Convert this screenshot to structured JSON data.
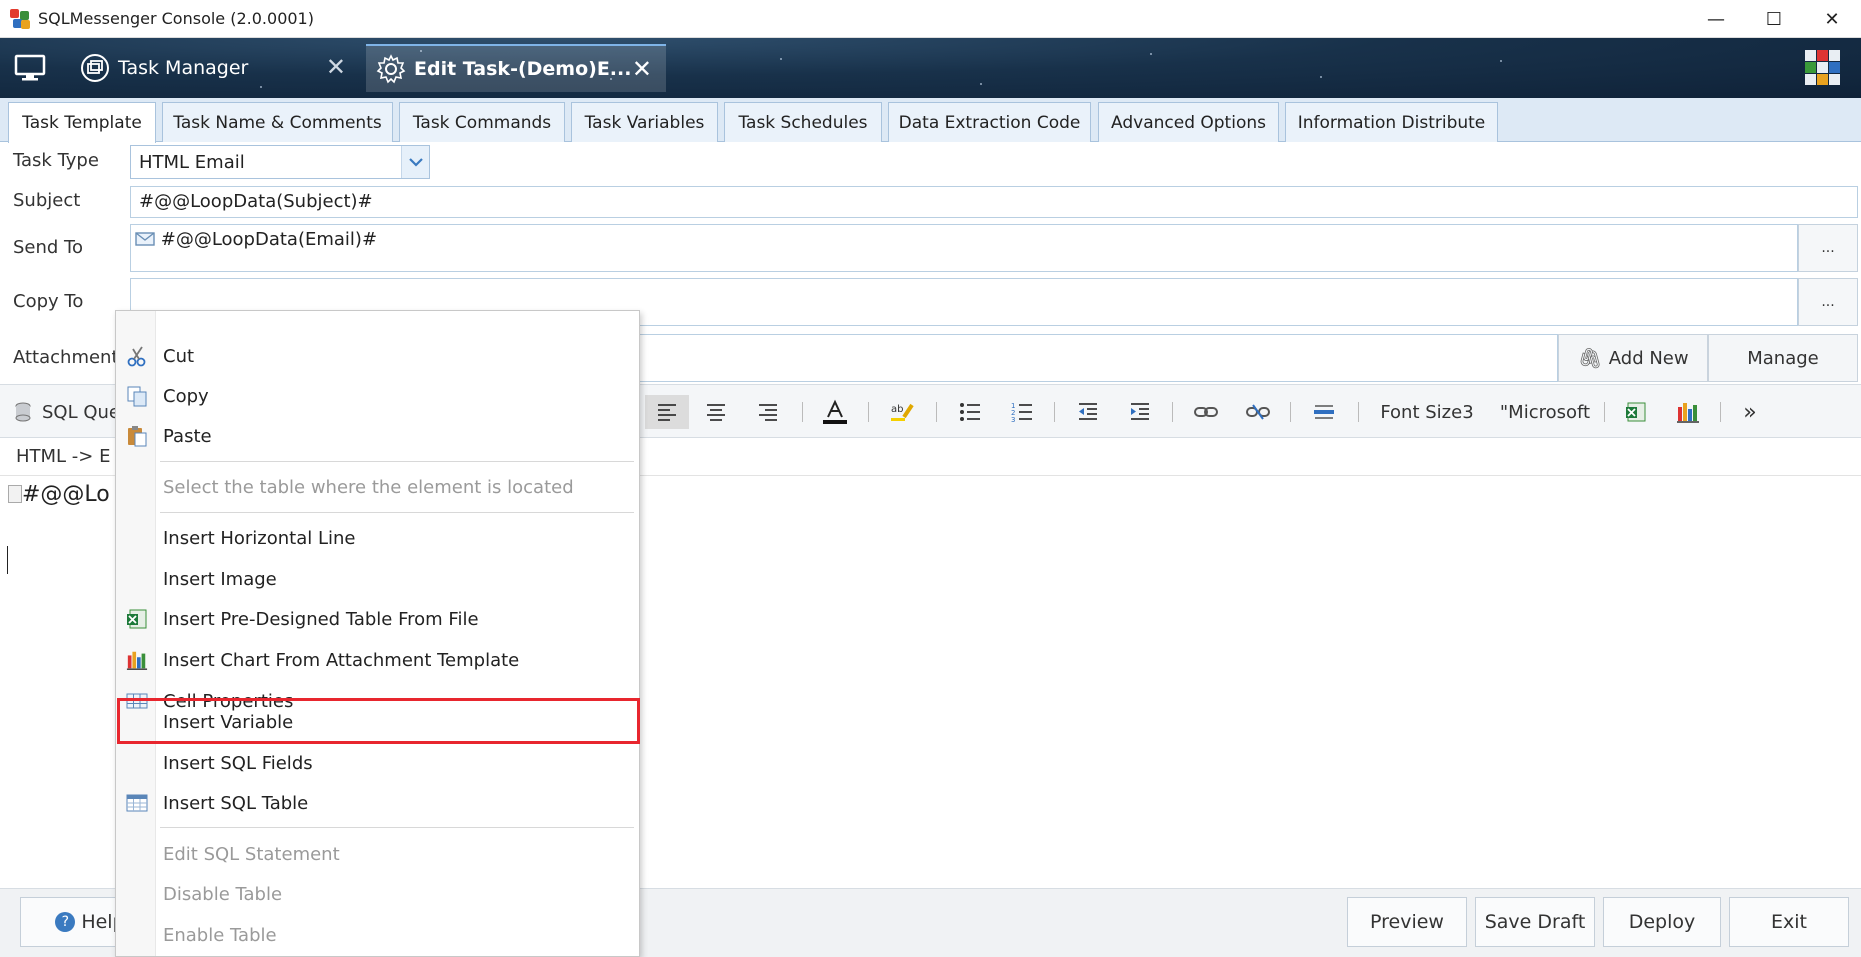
{
  "window": {
    "title": "SQLMessenger Console (2.0.0001)",
    "minimize": "—",
    "maximize": "☐",
    "close": "✕"
  },
  "header": {
    "tabs": [
      {
        "label": "Task Manager",
        "close": "✕"
      },
      {
        "label": "Edit Task-(Demo)E...",
        "close": "✕"
      }
    ]
  },
  "subtabs": [
    "Task Template",
    "Task Name & Comments",
    "Task Commands",
    "Task Variables",
    "Task Schedules",
    "Data Extraction Code",
    "Advanced Options",
    "Information Distribute"
  ],
  "form": {
    "task_type_label": "Task Type",
    "task_type_value": "HTML Email",
    "subject_label": "Subject",
    "subject_value": "#@@LoopData(Subject)#",
    "send_to_label": "Send To",
    "send_to_value": "#@@LoopData(Email)#",
    "copy_to_label": "Copy To",
    "copy_to_value": "",
    "attachment_label": "Attachment",
    "browse_label": "...",
    "add_new_label": "Add New",
    "manage_label": "Manage"
  },
  "toolbar": {
    "sql_query_label": "SQL Que",
    "font_size_label": "Font Size3",
    "font_name_label": "\"Microsoft"
  },
  "editor": {
    "path_text": "HTML  ->  E",
    "content_text": "#@@Lo"
  },
  "bottom": {
    "help_label": "Help",
    "preview_label": "Preview",
    "save_draft_label": "Save Draft",
    "deploy_label": "Deploy",
    "exit_label": "Exit"
  },
  "context_menu": {
    "items": [
      {
        "label": "Cut",
        "icon": "scissors-icon",
        "enabled": true
      },
      {
        "label": "Copy",
        "icon": "copy-icon",
        "enabled": true
      },
      {
        "label": "Paste",
        "icon": "paste-icon",
        "enabled": true
      },
      {
        "label": "Select the table where the element is located",
        "icon": "",
        "enabled": false
      },
      {
        "label": "Insert Horizontal Line",
        "icon": "",
        "enabled": true
      },
      {
        "label": "Insert Image",
        "icon": "",
        "enabled": true
      },
      {
        "label": "Insert Pre-Designed Table From File",
        "icon": "excel-icon",
        "enabled": true
      },
      {
        "label": "Insert Chart From Attachment Template",
        "icon": "chart-icon",
        "enabled": true
      },
      {
        "label": "Cell Properties",
        "icon": "table-icon",
        "enabled": true
      },
      {
        "label": "Insert Variable",
        "icon": "",
        "enabled": true,
        "highlighted": true
      },
      {
        "label": "Insert SQL Fields",
        "icon": "",
        "enabled": true
      },
      {
        "label": "Insert SQL Table",
        "icon": "sql-table-icon",
        "enabled": true
      },
      {
        "label": "Edit SQL Statement",
        "icon": "",
        "enabled": false
      },
      {
        "label": "Disable Table",
        "icon": "",
        "enabled": false
      },
      {
        "label": "Enable Table",
        "icon": "",
        "enabled": false
      }
    ]
  },
  "colors": {
    "highlight_border": "#e8262e",
    "tab_bar": "#dde9f5",
    "header_dark": "#18314a"
  }
}
